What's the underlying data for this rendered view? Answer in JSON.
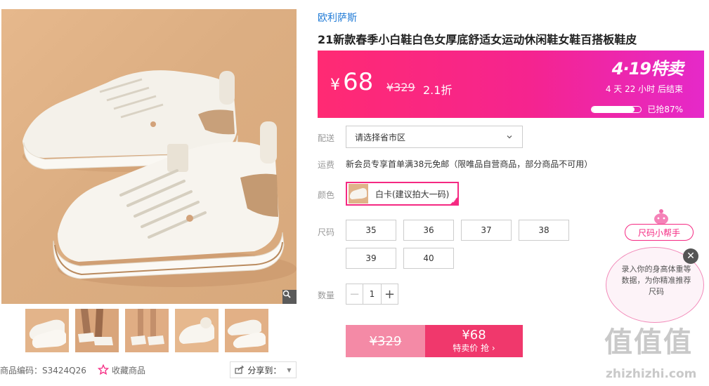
{
  "gallery": {
    "thumbnails": [
      "thumb-1",
      "thumb-2",
      "thumb-3",
      "thumb-4",
      "thumb-5"
    ],
    "active_thumbnail": 0
  },
  "meta": {
    "sku": "商品编码：S3424Q26",
    "favorite_label": "收藏商品",
    "share_label": "分享到："
  },
  "product": {
    "brand": "欧利萨斯",
    "title": "21新款春季小白鞋白色女厚底舒适女运动休闲鞋女鞋百搭板鞋皮"
  },
  "price_banner": {
    "currency": "¥",
    "price": "68",
    "original_price": "¥329",
    "discount": "2.1折",
    "event_title": "4·19特卖",
    "countdown": "4 天 22 小时 后结束",
    "sold_text": "已抢87%",
    "sold_fraction": 0.87,
    "gradient_start": "#ff2a73",
    "gradient_end": "#e529c9"
  },
  "options": {
    "delivery_label": "配送",
    "delivery_select": "请选择省市区",
    "shipping_label": "运费",
    "shipping_text": "新会员专享首单满38元免邮（限唯品自营商品，部分商品不可用）",
    "color_label": "颜色",
    "color_selected": "白卡(建议拍大一码)",
    "size_label": "尺码",
    "sizes": [
      "35",
      "36",
      "37",
      "38",
      "39",
      "40"
    ],
    "quantity_label": "数量",
    "quantity": "1"
  },
  "buy": {
    "original_price": "¥329",
    "price": "¥68",
    "action_label": "特卖价 抢 ›",
    "accent_color": "#f0386c"
  },
  "size_helper": {
    "tag": "尺码小帮手",
    "text": "录入你的身高体重等数据，为你精准推荐尺码"
  },
  "watermark": {
    "mark": "值值值",
    "site": "zhizhizhi.com"
  }
}
